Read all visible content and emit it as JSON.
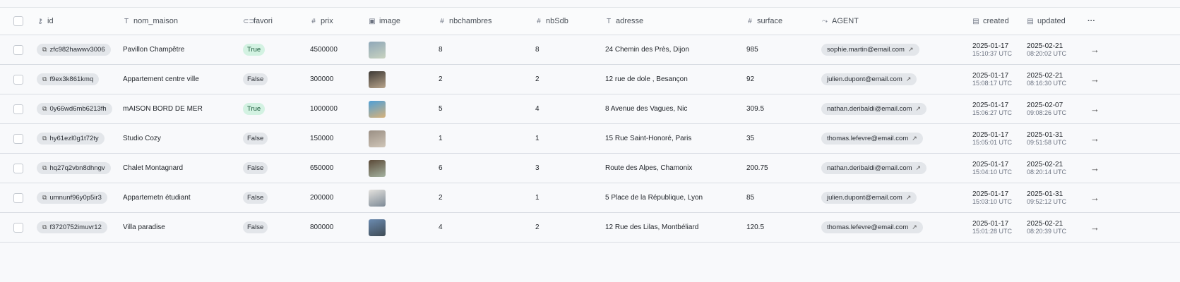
{
  "headers": {
    "id": {
      "icon": "key-icon",
      "label": "id"
    },
    "nom_maison": {
      "icon": "text-icon",
      "label": "nom_maison"
    },
    "favori": {
      "icon": "toggle-icon",
      "label": "favori"
    },
    "prix": {
      "icon": "hash-icon",
      "label": "prix"
    },
    "image": {
      "icon": "image-icon",
      "label": "image"
    },
    "nbchambres": {
      "icon": "hash-icon",
      "label": "nbchambres"
    },
    "nbsdb": {
      "icon": "hash-icon",
      "label": "nbSdb"
    },
    "adresse": {
      "icon": "text-icon",
      "label": "adresse"
    },
    "surface": {
      "icon": "hash-icon",
      "label": "surface"
    },
    "agent": {
      "icon": "relation-icon",
      "label": "AGENT"
    },
    "created": {
      "icon": "calendar-icon",
      "label": "created"
    },
    "updated": {
      "icon": "calendar-icon",
      "label": "updated"
    },
    "more": "···"
  },
  "rows": [
    {
      "id": "zfc982hawwv3006",
      "nom_maison": "Pavillon Champêtre",
      "favori": "True",
      "prix": "4500000",
      "image_colors": [
        "#8fa7b8",
        "#c9d3c0"
      ],
      "nbchambres": "8",
      "nbsdb": "8",
      "adresse": "24 Chemin des Près, Dijon",
      "surface": "985",
      "agent": "sophie.martin@email.com",
      "created_date": "2025-01-17",
      "created_time": "15:10:37 UTC",
      "updated_date": "2025-02-21",
      "updated_time": "08:20:02 UTC"
    },
    {
      "id": "f9ex3k861kmq",
      "nom_maison": "Appartement centre ville",
      "favori": "False",
      "prix": "300000",
      "image_colors": [
        "#3e3a36",
        "#b9a58c"
      ],
      "nbchambres": "2",
      "nbsdb": "2",
      "adresse": "12 rue de dole , Besançon",
      "surface": "92",
      "agent": "julien.dupont@email.com",
      "created_date": "2025-01-17",
      "created_time": "15:08:17 UTC",
      "updated_date": "2025-02-21",
      "updated_time": "08:16:30 UTC"
    },
    {
      "id": "0y66wd6mb6213fh",
      "nom_maison": "mAISON BORD DE MER",
      "favori": "True",
      "prix": "1000000",
      "image_colors": [
        "#4f9fd6",
        "#d8b27a"
      ],
      "nbchambres": "5",
      "nbsdb": "4",
      "adresse": "8 Avenue des Vagues, Nic",
      "surface": "309.5",
      "agent": "nathan.deribaldi@email.com",
      "created_date": "2025-01-17",
      "created_time": "15:06:27 UTC",
      "updated_date": "2025-02-07",
      "updated_time": "09:08:26 UTC"
    },
    {
      "id": "hy61ezl0g1t72ty",
      "nom_maison": "Studio Cozy",
      "favori": "False",
      "prix": "150000",
      "image_colors": [
        "#9a8f84",
        "#d0c6b8"
      ],
      "nbchambres": "1",
      "nbsdb": "1",
      "adresse": "15 Rue Saint-Honoré, Paris",
      "surface": "35",
      "agent": "thomas.lefevre@email.com",
      "created_date": "2025-01-17",
      "created_time": "15:05:01 UTC",
      "updated_date": "2025-01-31",
      "updated_time": "09:51:58 UTC"
    },
    {
      "id": "hq27q2vbn8dhngv",
      "nom_maison": "Chalet Montagnard",
      "favori": "False",
      "prix": "650000",
      "image_colors": [
        "#5b4a38",
        "#a5b3a1"
      ],
      "nbchambres": "6",
      "nbsdb": "3",
      "adresse": "Route des Alpes, Chamonix",
      "surface": "200.75",
      "agent": "nathan.deribaldi@email.com",
      "created_date": "2025-01-17",
      "created_time": "15:04:10 UTC",
      "updated_date": "2025-02-21",
      "updated_time": "08:20:14 UTC"
    },
    {
      "id": "umnunf96y0p5ir3",
      "nom_maison": "Appartemetn étudiant",
      "favori": "False",
      "prix": "200000",
      "image_colors": [
        "#e4e2de",
        "#7d8a96"
      ],
      "nbchambres": "2",
      "nbsdb": "1",
      "adresse": "5 Place de la République, Lyon",
      "surface": "85",
      "agent": "julien.dupont@email.com",
      "created_date": "2025-01-17",
      "created_time": "15:03:10 UTC",
      "updated_date": "2025-01-31",
      "updated_time": "09:52:12 UTC"
    },
    {
      "id": "f3720752imuvr12",
      "nom_maison": "Villa paradise",
      "favori": "False",
      "prix": "800000",
      "image_colors": [
        "#6b8bb0",
        "#3f4b55"
      ],
      "nbchambres": "4",
      "nbsdb": "2",
      "adresse": "12 Rue des Lilas, Montbéliard",
      "surface": "120.5",
      "agent": "thomas.lefevre@email.com",
      "created_date": "2025-01-17",
      "created_time": "15:01:28 UTC",
      "updated_date": "2025-02-21",
      "updated_time": "08:20:39 UTC"
    }
  ]
}
